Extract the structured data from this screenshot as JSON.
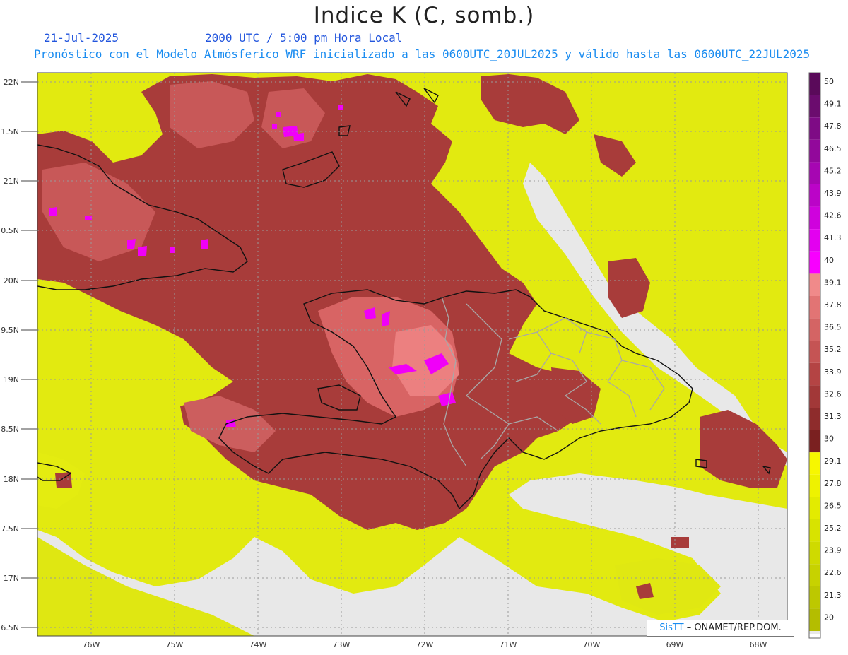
{
  "title": "Indice K (C, somb.)",
  "date_label": "21-Jul-2025",
  "time_label": "2000 UTC / 5:00 pm Hora Local",
  "description": "Pronóstico con el Modelo Atmósferico WRF inicializado a las 0600UTC_20JUL2025 y válido hasta las  0600UTC_22JUL2025",
  "credit": {
    "brand": "SisTT",
    "org": " – ONAMET/REP.DOM."
  },
  "map": {
    "lat_labels": [
      "22N",
      "1.5N",
      "21N",
      "0.5N",
      "20N",
      "9.5N",
      "19N",
      "8.5N",
      "18N",
      "7.5N",
      "17N",
      "6.5N"
    ],
    "lon_labels": [
      "76W",
      "75W",
      "74W",
      "73W",
      "72W",
      "71W",
      "70W",
      "69W",
      "68W"
    ]
  },
  "colorbar": {
    "levels": [
      "50",
      "49.1",
      "47.8",
      "46.5",
      "45.2",
      "43.9",
      "42.6",
      "41.3",
      "40",
      "39.1",
      "37.8",
      "36.5",
      "35.2",
      "33.9",
      "32.6",
      "31.3",
      "30",
      "29.1",
      "27.8",
      "26.5",
      "25.2",
      "23.9",
      "22.6",
      "21.3",
      "20"
    ],
    "colors": [
      "#5a0a5a",
      "#6b0c6e",
      "#7e0b85",
      "#92089b",
      "#a606b2",
      "#bb04c8",
      "#cf02dd",
      "#e300f0",
      "#f800ff",
      "#f08a8a",
      "#e27474",
      "#d46464",
      "#c55454",
      "#b44444",
      "#a23838",
      "#8e2c2c",
      "#7a2020",
      "#f7f700",
      "#eef200",
      "#e3eb00",
      "#d8e300",
      "#cfda00",
      "#c7d200",
      "#bdc800",
      "#b4bd00"
    ],
    "below_color": "#e8e8e8"
  }
}
